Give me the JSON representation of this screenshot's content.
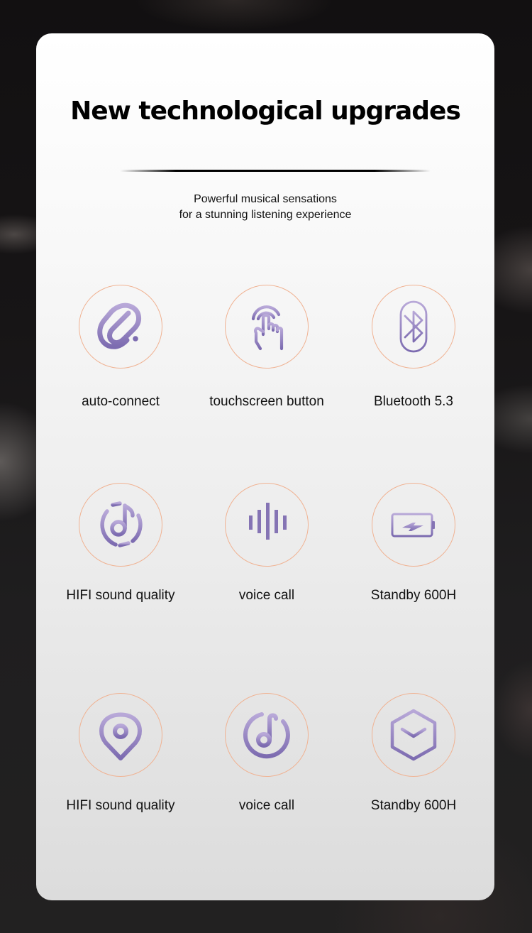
{
  "header": {
    "title": "New technological upgrades",
    "subtitle_line1": "Powerful musical sensations",
    "subtitle_line2": "for a stunning listening experience"
  },
  "colors": {
    "icon_gradient_top": "#b8a8d8",
    "icon_gradient_bottom": "#7c6bb0",
    "ring": "#f0b292",
    "title": "#000000"
  },
  "features": [
    {
      "label": "auto-connect",
      "icon": "paperclip-icon"
    },
    {
      "label": "touchscreen button",
      "icon": "touch-hand-icon"
    },
    {
      "label": "Bluetooth 5.3",
      "icon": "bluetooth-icon"
    },
    {
      "label": "HIFI sound quality",
      "icon": "music-disc-icon"
    },
    {
      "label": "voice call",
      "icon": "sound-wave-icon"
    },
    {
      "label": "Standby 600H",
      "icon": "battery-charging-icon"
    },
    {
      "label": "HIFI sound quality",
      "icon": "location-pin-icon"
    },
    {
      "label": "voice call",
      "icon": "music-note-circle-icon"
    },
    {
      "label": "Standby 600H",
      "icon": "cube-icon"
    }
  ]
}
